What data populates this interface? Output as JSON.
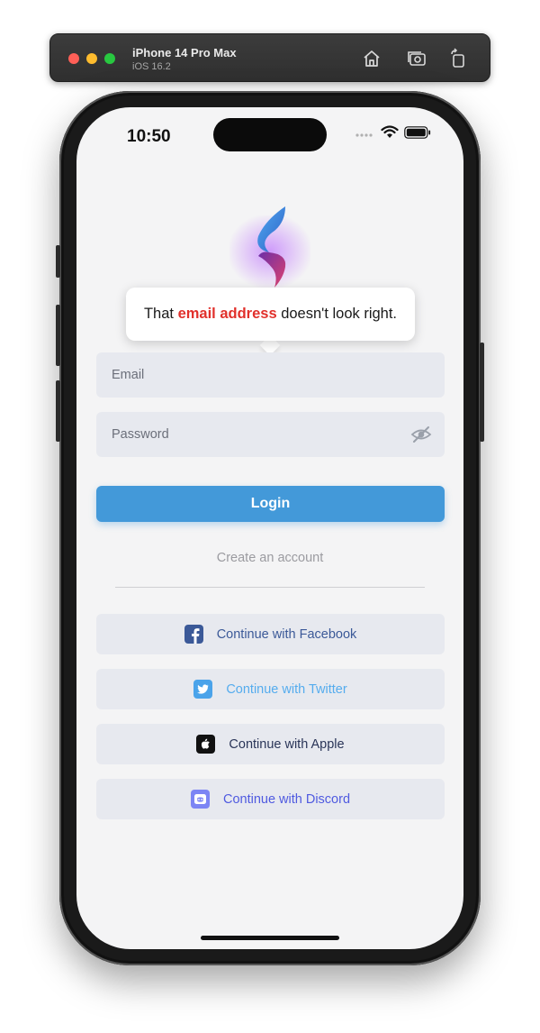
{
  "simulator": {
    "device_name": "iPhone 14 Pro Max",
    "os_version": "iOS 16.2",
    "buttons": [
      "home-icon",
      "screenshot-icon",
      "rotate-icon"
    ]
  },
  "status_bar": {
    "time": "10:50"
  },
  "tooltip": {
    "prefix": "That ",
    "highlight": "email address",
    "suffix": " doesn't look right.",
    "highlight_color": "#e1302b"
  },
  "form": {
    "email_placeholder": "Email",
    "password_placeholder": "Password",
    "login_label": "Login",
    "create_account_label": "Create an account"
  },
  "social": [
    {
      "label": "Continue with Facebook",
      "icon": "facebook-icon",
      "color": "#3b5998"
    },
    {
      "label": "Continue with Twitter",
      "icon": "twitter-icon",
      "color": "#55acee"
    },
    {
      "label": "Continue with Apple",
      "icon": "apple-icon",
      "color": "#2a3558"
    },
    {
      "label": "Continue with Discord",
      "icon": "discord-icon",
      "color": "#5865f2"
    }
  ],
  "colors": {
    "accent": "#4399d9",
    "field_bg": "#e7e9ef",
    "screen_bg": "#f4f4f5"
  }
}
